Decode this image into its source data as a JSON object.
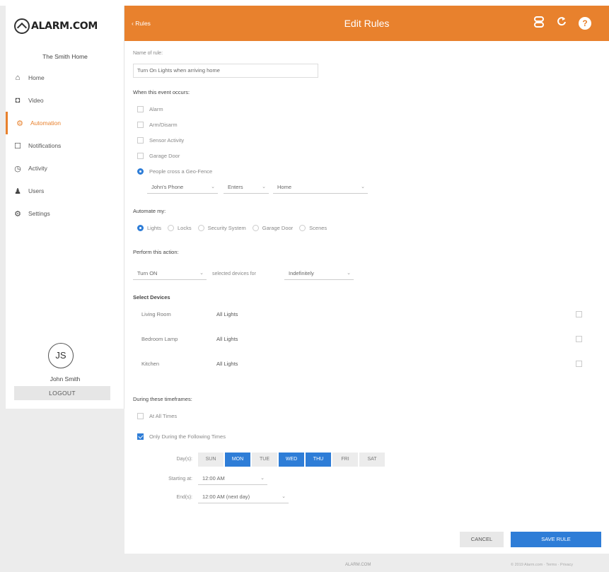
{
  "app": {
    "logo_text": "ALARM.COM",
    "home_name": "The Smith Home"
  },
  "sidebar": {
    "items": [
      {
        "label": "Home",
        "icon": "home-icon",
        "glyph": "⌂"
      },
      {
        "label": "Video",
        "icon": "video-camera-icon",
        "glyph": "◘"
      },
      {
        "label": "Automation",
        "icon": "automation-icon",
        "glyph": "⚙"
      },
      {
        "label": "Notifications",
        "icon": "notifications-icon",
        "glyph": "☐"
      },
      {
        "label": "Activity",
        "icon": "activity-icon",
        "glyph": "◷"
      },
      {
        "label": "Users",
        "icon": "users-icon",
        "glyph": "♟"
      },
      {
        "label": "Settings",
        "icon": "settings-icon",
        "glyph": "⚙"
      }
    ],
    "active_item": "Automation",
    "user": {
      "initials": "JS",
      "name": "John Smith"
    },
    "logout_label": "LOGOUT"
  },
  "header": {
    "back_label": "‹ Rules",
    "title": "Edit Rules",
    "icons": [
      "device-sync-icon",
      "refresh-icon",
      "help-icon"
    ]
  },
  "form": {
    "rule_name_label": "Name of rule:",
    "rule_name_value": "Turn On Lights when arriving home",
    "event_section": "When this event occurs:",
    "events": [
      {
        "label": "Alarm",
        "checked": false
      },
      {
        "label": "Arm/Disarm",
        "checked": false
      },
      {
        "label": "Sensor Activity",
        "checked": false
      },
      {
        "label": "Garage Door",
        "checked": false
      },
      {
        "label": "People cross a Geo-Fence",
        "checked": true
      }
    ],
    "geofence": {
      "device": "John's Phone",
      "action": "Enters",
      "location": "Home"
    },
    "automate_section": "Automate my:",
    "automate_options": [
      {
        "label": "Lights",
        "checked": true
      },
      {
        "label": "Locks",
        "checked": false
      },
      {
        "label": "Security System",
        "checked": false
      },
      {
        "label": "Garage Door",
        "checked": false
      },
      {
        "label": "Scenes",
        "checked": false
      }
    ],
    "perform_section": "Perform this action:",
    "perform": {
      "action": "Turn ON",
      "middle_text": "selected devices for",
      "duration": "Indefinitely"
    },
    "devices_section": "Select Devices",
    "devices": [
      {
        "room": "Living Room",
        "device": "All Lights",
        "checked": false
      },
      {
        "room": "Bedroom Lamp",
        "device": "All Lights",
        "checked": false
      },
      {
        "room": "Kitchen",
        "device": "All Lights",
        "checked": false
      }
    ],
    "time_section": "During these timeframes:",
    "time_options": [
      {
        "label": "At All Times",
        "checked": false
      },
      {
        "label": "Only During the Following Times",
        "checked": true
      }
    ],
    "days_label": "Day(s):",
    "days": [
      {
        "label": "SUN",
        "on": false
      },
      {
        "label": "MON",
        "on": true
      },
      {
        "label": "TUE",
        "on": false
      },
      {
        "label": "WED",
        "on": true
      },
      {
        "label": "THU",
        "on": true
      },
      {
        "label": "FRI",
        "on": false
      },
      {
        "label": "SAT",
        "on": false
      }
    ],
    "starting_label": "Starting at:",
    "starting_value": "12:00 AM",
    "ending_label": "End(s):",
    "ending_value": "12:00 AM (next day)",
    "cancel_label": "CANCEL",
    "save_label": "SAVE RULE"
  },
  "footer": {
    "logo_text": "ALARM.COM",
    "links": "© 2019 Alarm.com · Terms · Privacy"
  },
  "colors": {
    "accent": "#e8812d",
    "selected": "#2e7dd7"
  }
}
